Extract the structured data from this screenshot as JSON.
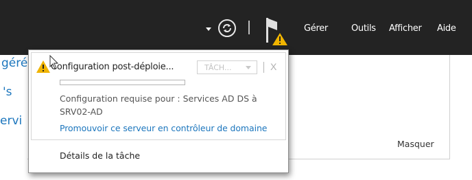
{
  "header": {
    "menu": [
      "Gérer",
      "Outils",
      "Afficher",
      "Aide"
    ]
  },
  "background": {
    "left_fragments": [
      "géré",
      "'s",
      "ervi"
    ],
    "hide_label": "Masquer"
  },
  "notification": {
    "title": "Configuration post-déploie...",
    "task_dropdown": "TÂCH...",
    "close": "X",
    "progress_fraction": 0.0,
    "description": "Configuration requise pour : Services AD DS à SRV02-AD",
    "action_link": "Promouvoir ce serveur en contrôleur de domaine",
    "task_details": "Détails de la tâche"
  },
  "colors": {
    "topbar": "#232323",
    "link": "#1c76bd",
    "warning": "#f0b400"
  }
}
